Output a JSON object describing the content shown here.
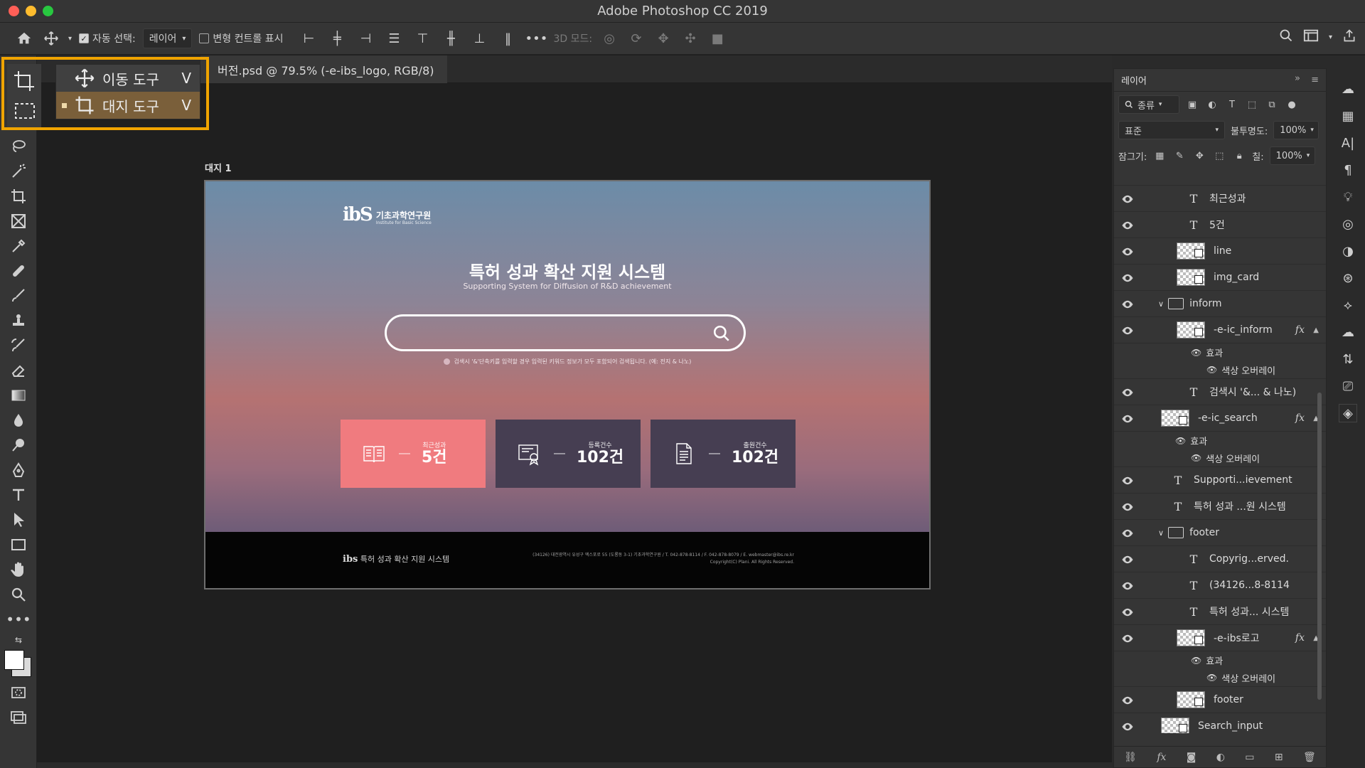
{
  "window": {
    "title": "Adobe Photoshop CC 2019"
  },
  "options": {
    "auto_select_label": "자동 선택:",
    "auto_select_value": "레이어",
    "transform_label": "변형 컨트롤 표시",
    "mode_3d_label": "3D 모드:"
  },
  "document": {
    "tab_title": "버전.psd @ 79.5% (-e-ibs_logo, RGB/8)"
  },
  "flyout": {
    "items": [
      {
        "label": "이동 도구",
        "key": "V"
      },
      {
        "label": "대지 도구",
        "key": "V"
      }
    ]
  },
  "artboard": {
    "label": "대지 1",
    "logo_mark": "ibS",
    "logo_ko": "기초과학연구원",
    "logo_en": "Institute for Basic Science",
    "title": "특허 성과 확산 지원 시스템",
    "subtitle": "Supporting System for Diffusion of R&D achievement",
    "hint": "검색시 '&'단축키를 입력할 경우 입력된 키워드 정보가 모두 포함되어 검색됩니다. (예: 전지 & 나노)",
    "cards": [
      {
        "label": "최근성과",
        "value": "5건"
      },
      {
        "label": "등록건수",
        "value": "102건"
      },
      {
        "label": "출원건수",
        "value": "102건"
      }
    ],
    "footer_logo": "ibs",
    "footer_title": "특허 성과 확산 지원 시스템",
    "footer_address": "(34126) 대전광역시 유성구 엑스포로 55 (도룡동 3-1) 기초과학연구원 / T. 042-878-8114 / F. 042-878-8079 / E. webmaster@ibs.re.kr",
    "footer_copyright": "Copyright(C) Plani. All Rights Reserved."
  },
  "layers_panel": {
    "title": "레이어",
    "filter_label": "종류",
    "blend_mode": "표준",
    "opacity_label": "불투명도:",
    "opacity_value": "100%",
    "lock_label": "잠그기:",
    "fill_label": "칠:",
    "fill_value": "100%",
    "layers": [
      {
        "kind": "text",
        "name": "최근성과",
        "indent": 2
      },
      {
        "kind": "text",
        "name": "5건",
        "indent": 2
      },
      {
        "kind": "smart",
        "name": "line",
        "indent": 2
      },
      {
        "kind": "smart",
        "name": "img_card",
        "indent": 2
      },
      {
        "kind": "folder",
        "name": "inform",
        "indent": 1
      },
      {
        "kind": "smart",
        "name": "-e-ic_inform",
        "indent": 2,
        "fx": true
      },
      {
        "kind": "effect",
        "name": "효과",
        "indent": 3
      },
      {
        "kind": "effect",
        "name": "색상 오버레이",
        "indent": 4
      },
      {
        "kind": "text",
        "name": "검색시 '&... & 나노)",
        "indent": 2
      },
      {
        "kind": "smart",
        "name": "-e-ic_search",
        "indent": 1,
        "fx": true
      },
      {
        "kind": "effect",
        "name": "효과",
        "indent": 2
      },
      {
        "kind": "effect",
        "name": "색상 오버레이",
        "indent": 3
      },
      {
        "kind": "text",
        "name": "Supporti...ievement",
        "indent": 1
      },
      {
        "kind": "text",
        "name": "특허 성과 ...원 시스템",
        "indent": 1
      },
      {
        "kind": "folder",
        "name": "footer",
        "indent": 1
      },
      {
        "kind": "text",
        "name": "Copyrig...erved.",
        "indent": 2
      },
      {
        "kind": "text",
        "name": "(34126...8-8114",
        "indent": 2
      },
      {
        "kind": "text",
        "name": "특허 성과... 시스템",
        "indent": 2
      },
      {
        "kind": "smart",
        "name": "-e-ibs로고",
        "indent": 2,
        "fx": true
      },
      {
        "kind": "effect",
        "name": "효과",
        "indent": 3
      },
      {
        "kind": "effect",
        "name": "색상 오버레이",
        "indent": 4
      },
      {
        "kind": "smart",
        "name": "footer",
        "indent": 2
      },
      {
        "kind": "smart",
        "name": "Search_input",
        "indent": 1
      }
    ]
  },
  "colors": {
    "accent_highlight": "#f0a400",
    "card_active": "#f07b7f",
    "card_dark": "#463e52"
  }
}
